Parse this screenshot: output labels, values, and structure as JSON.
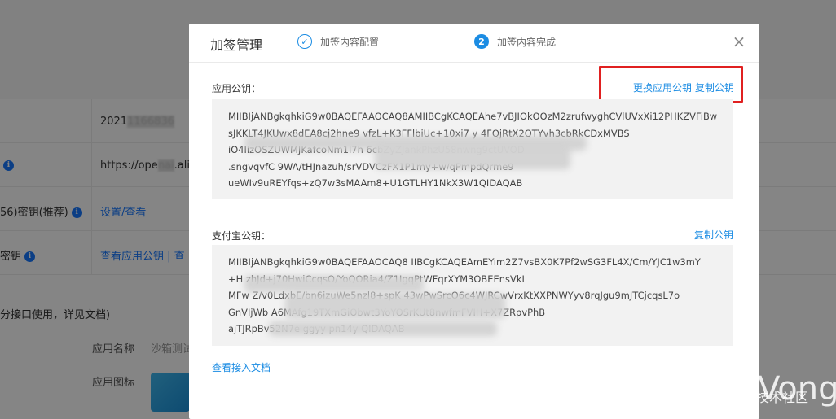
{
  "background": {
    "rows": [
      {
        "left_text": "",
        "value": "2021",
        "masked_value": "1166836"
      },
      {
        "left_text": "",
        "value": "https://ope",
        "masked_value": ".ali"
      },
      {
        "left_text": "56)密钥(推荐)",
        "value": "设置/查看"
      },
      {
        "left_text": "密钥",
        "value": "查看应用公钥 | 查"
      }
    ],
    "note": "分接口使用，详见文档)",
    "app_name_label": "应用名称",
    "app_name_value": "沙箱测试",
    "app_icon_label": "应用图标"
  },
  "modal": {
    "title": "加签管理",
    "steps": [
      {
        "number": "✓",
        "label": "加签内容配置"
      },
      {
        "number": "2",
        "label": "加签内容完成"
      }
    ],
    "app_public_key": {
      "label": "应用公钥：",
      "actions": [
        "更换应用公钥",
        "复制公钥"
      ],
      "lines": [
        "MIIBIjANBgkqhkiG9w0BAQEFAAOCAQ8AMIIBCgKCAQEAhe7vBJIOkOOzM2zrufwyghCVlUVxXi12PHKZVFiBw",
        "sJKKLT4JKUwx8dEA8cj2hne9        vfzL+K3FFlbiUc+10xi7       y                          4FQjRtX2QTYvh3cbRkCDxMVBS",
        "iO4IizOSZUWMJKafcoNm1l7h                                                           6cbZyZJankPhzU58nwng9ctUVOD",
        "                                        .sngvqvfC                                          9WA/tHJnazuh/srVDVCzFX1P1my+w/qPmpdQrme9",
        "ueWIv9uREYfqs+zQ7w3sMAAm8+U1GTLHY1NkX3W1QIDAQAB"
      ]
    },
    "alipay_public_key": {
      "label": "支付宝公钥：",
      "actions": [
        "复制公钥"
      ],
      "lines": [
        "MIIBIjANBgkqhkiG9w0BAQEFAAOCAQ8             IIBCgKCAQEAmEYim2Z7vsBX0K7Pf2wSG3FL4X/Cm/YJC1w3mY",
        "+H                                                    zhJd+j70HwiCcqsO/YoQORia4/Z1IgqPtWFqrXYM3OBEEnsVkI",
        "MFw         Z/v0LdxbE/bn6izuWe5nzl8+spK          43wPwSrcO6c4WJRCwVrxKtXXPNWYyv8rqJgu9mJTCjcqsL7o",
        "GnVIjWb                                                       A6MAfg19TXmGiObwt3YoYOSrKUt8nwfmFVIH+X7ZRpvPhB",
        "ajTJRpBv52N7e               ggyy                       pn14y              QIDAQAB"
      ]
    },
    "doc_link": "查看接入文档"
  },
  "watermark": {
    "text": "@稀土掘金技术社区",
    "signature": "Vong"
  },
  "colors": {
    "accent": "#1b8ce3",
    "highlight": "#e02020",
    "mask": "rgba(0,0,0,0.48)"
  }
}
